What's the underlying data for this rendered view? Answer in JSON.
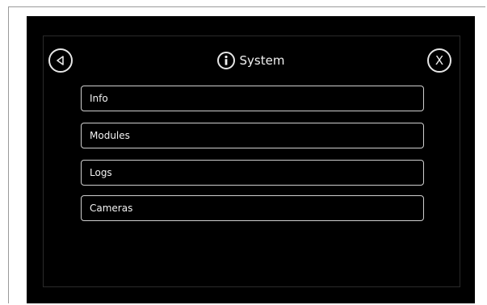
{
  "header": {
    "title": "System",
    "title_icon": "info-icon",
    "back_icon": "back-triangle-icon",
    "close_label": "X"
  },
  "menu": {
    "items": [
      {
        "label": "Info"
      },
      {
        "label": "Modules"
      },
      {
        "label": "Logs"
      },
      {
        "label": "Cameras"
      }
    ]
  },
  "colors": {
    "screen_background": "#000000",
    "foreground": "#f2f2f2",
    "button_border": "#cfcfcf"
  }
}
